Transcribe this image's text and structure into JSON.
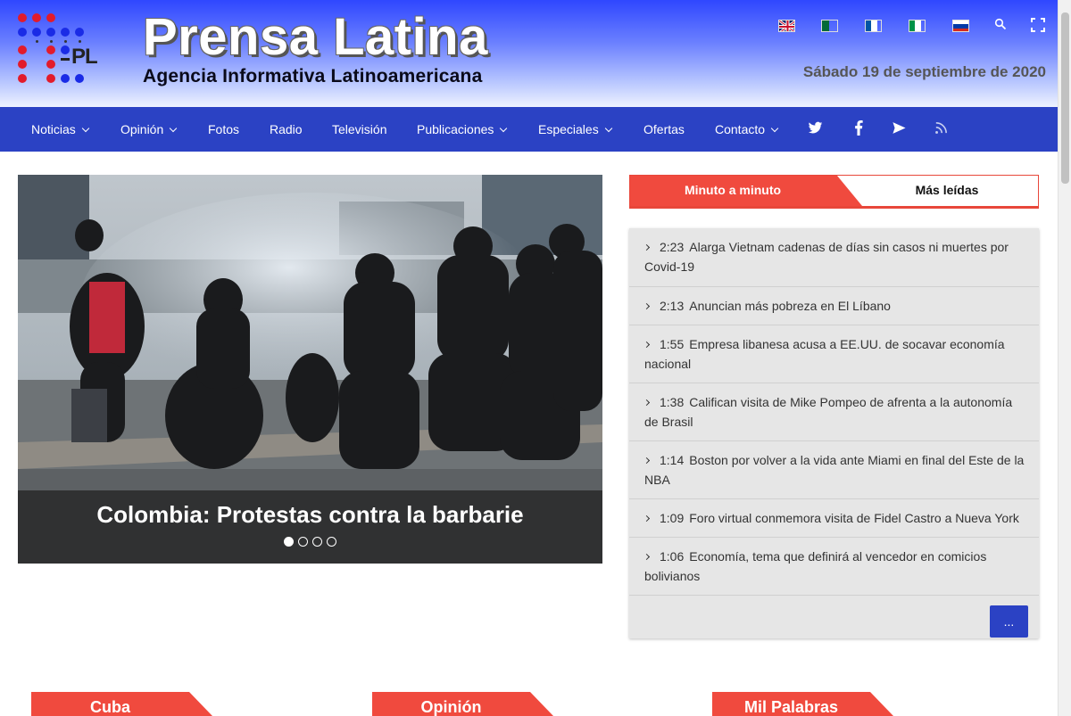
{
  "header": {
    "brand": "Prensa Latina",
    "tagline": "Agencia Informativa Latinoamericana",
    "logo_text": "PL",
    "date": "Sábado 19 de septiembre de 2020",
    "languages": [
      "english-flag-icon",
      "portuguese-flag-icon",
      "french-flag-icon",
      "italian-flag-icon",
      "russian-flag-icon"
    ],
    "tools": [
      "search-icon",
      "fullscreen-icon"
    ]
  },
  "nav": {
    "items": [
      {
        "label": "Noticias",
        "dropdown": true
      },
      {
        "label": "Opinión",
        "dropdown": true
      },
      {
        "label": "Fotos",
        "dropdown": false
      },
      {
        "label": "Radio",
        "dropdown": false
      },
      {
        "label": "Televisión",
        "dropdown": false
      },
      {
        "label": "Publicaciones",
        "dropdown": true
      },
      {
        "label": "Especiales",
        "dropdown": true
      },
      {
        "label": "Ofertas",
        "dropdown": false
      },
      {
        "label": "Contacto",
        "dropdown": true
      }
    ],
    "social": [
      "twitter-icon",
      "facebook-icon",
      "telegram-icon",
      "rss-icon"
    ]
  },
  "slider": {
    "caption": "Colombia: Protestas contra la barbarie",
    "slide_count": 4,
    "active_slide": 1
  },
  "sidebar": {
    "tabs": [
      "Minuto a minuto",
      "Más leídas"
    ],
    "active_tab": "Minuto a minuto",
    "news": [
      {
        "time": "2:23",
        "title": "Alarga Vietnam cadenas de días sin casos ni muertes por Covid-19"
      },
      {
        "time": "2:13",
        "title": "Anuncian más pobreza en El Líbano"
      },
      {
        "time": "1:55",
        "title": "Empresa libanesa acusa a EE.UU. de socavar economía nacional"
      },
      {
        "time": "1:38",
        "title": "Califican visita de Mike Pompeo de afrenta a la autonomía de Brasil"
      },
      {
        "time": "1:14",
        "title": "Boston por volver a la vida ante Miami en final del Este de la NBA"
      },
      {
        "time": "1:09",
        "title": "Foro virtual conmemora visita de Fidel Castro a Nueva York"
      },
      {
        "time": "1:06",
        "title": "Economía, tema que definirá al vencedor en comicios bolivianos"
      }
    ],
    "more_label": "..."
  },
  "sections": [
    "Cuba",
    "Opinión",
    "Mil Palabras"
  ],
  "colors": {
    "nav": "#2b42c4",
    "accent_red": "#f04a3e",
    "panel_gray": "#e6e6e6"
  }
}
